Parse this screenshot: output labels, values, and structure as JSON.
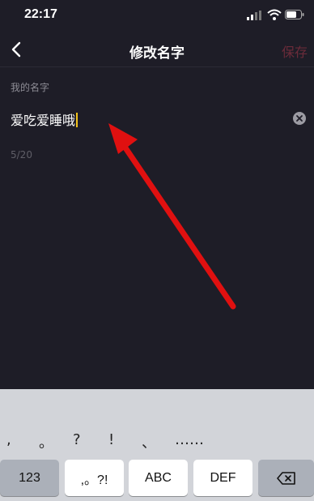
{
  "status_bar": {
    "time": "22:17"
  },
  "header": {
    "title": "修改名字",
    "save_label": "保存"
  },
  "name_section": {
    "label": "我的名字",
    "value": "爱吃爱睡哦",
    "counter": "5/20"
  },
  "keyboard": {
    "suggestions": [
      ",",
      "。",
      "?",
      "!",
      "、",
      "……"
    ],
    "keys": [
      "123",
      ",。?!",
      "ABC",
      "DEF"
    ]
  },
  "colors": {
    "background": "#1e1d27",
    "save_disabled": "#6b2b3a",
    "caret": "#f3c21a",
    "annotation_arrow": "#e01010"
  },
  "icons": [
    "back-chevron-icon",
    "clear-icon",
    "delete-key-icon",
    "signal-icon",
    "wifi-icon",
    "battery-icon"
  ]
}
